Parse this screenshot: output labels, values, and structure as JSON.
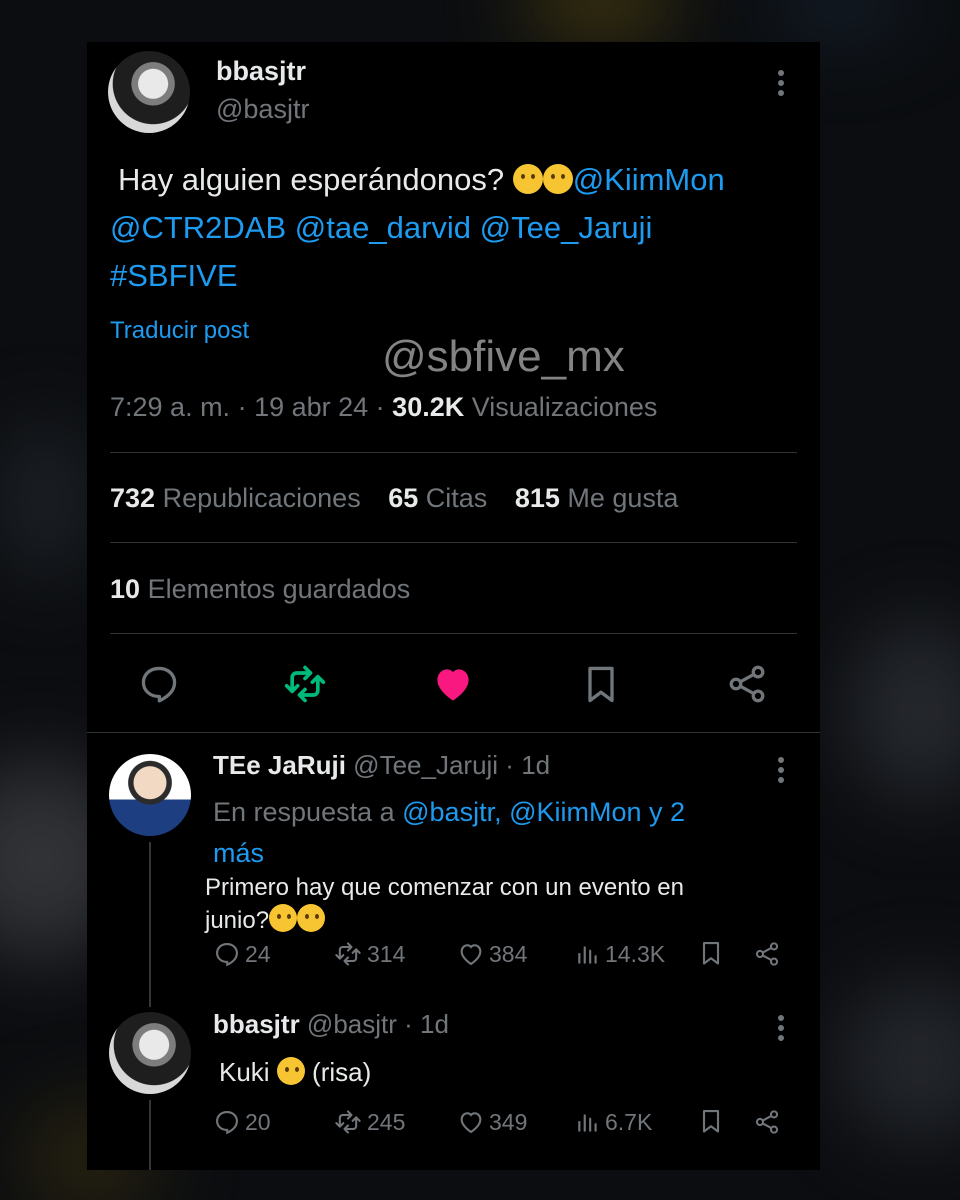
{
  "main_post": {
    "display_name": "bbasjtr",
    "handle": "@basjtr",
    "text_start": "Hay alguien esperándonos? ",
    "emojis": [
      "thinking-face",
      "face-with-monocle"
    ],
    "mention_1": "@KiimMon",
    "mention_2": "@CTR2DAB",
    "mention_3": "@tae_darvid",
    "mention_4": "@Tee_Jaruji",
    "hashtag": "#SBFIVE",
    "translate": "Traducir post",
    "watermark": "@sbfive_mx",
    "time": "7:29 a. m.",
    "date": "19 abr 24",
    "views_count": "30.2K",
    "views_label": "Visualizaciones",
    "reposts_count": "732",
    "reposts_label": "Republicaciones",
    "quotes_count": "65",
    "quotes_label": "Citas",
    "likes_count": "815",
    "likes_label": "Me gusta",
    "bookmarks_count": "10",
    "bookmarks_label": "Elementos guardados",
    "liked": true
  },
  "replies": [
    {
      "display_name": "TEe JaRuji",
      "handle": "@Tee_Jaruji",
      "age": "1d",
      "reply_prefix": "En respuesta a ",
      "reply_to": "@basjtr, @KiimMon y 2",
      "reply_to_2": "más",
      "text_line1": "Primero hay que  comenzar con un evento en",
      "text_line2": "junio?",
      "emojis": [
        "face-with-hand-over-mouth",
        "face-with-hand-over-mouth"
      ],
      "comments": "24",
      "reposts": "314",
      "likes": "384",
      "views": "14.3K"
    },
    {
      "display_name": "bbasjtr",
      "handle": "@basjtr",
      "age": "1d",
      "text_start": "Kuki ",
      "emojis": [
        "face-with-hand-over-mouth"
      ],
      "text_end": " (risa)",
      "comments": "20",
      "reposts": "245",
      "likes": "349",
      "views": "6.7K"
    }
  ],
  "colors": {
    "link": "#1d9bf0",
    "repost_active": "#00ba7c",
    "like_active": "#f91880",
    "muted": "#71767b",
    "text": "#e7e9ea"
  }
}
